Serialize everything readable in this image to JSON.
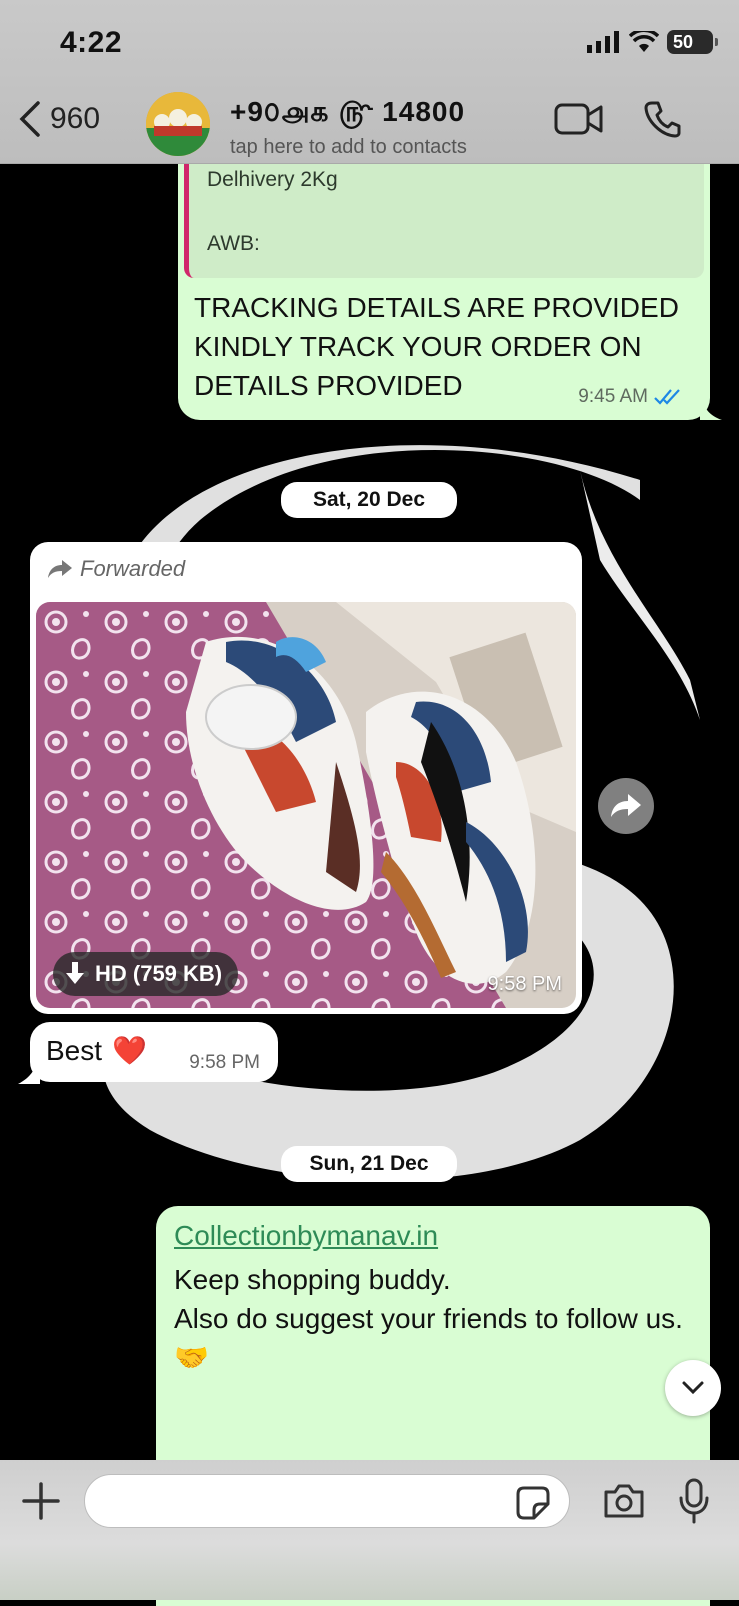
{
  "status_bar": {
    "time": "4:22",
    "battery": "50"
  },
  "header": {
    "back_count": "960",
    "contact_name": "+9௦௮௧ ௹ 14800",
    "contact_sub": "tap here to add to contacts"
  },
  "messages": {
    "m1": {
      "quote_line1": "Delhivery 2Kg",
      "quote_line2": "AWB:",
      "text": "TRACKING DETAILS ARE PROVIDED KINDLY TRACK YOUR ORDER ON DETAILS PROVIDED",
      "time": "9:45 AM"
    },
    "date1": "Sat, 20 Dec",
    "m2": {
      "forwarded": "Forwarded",
      "hd_label": "HD (759 KB)",
      "time": "9:58 PM"
    },
    "m3": {
      "text": "Best",
      "emoji": "❤️",
      "time": "9:58 PM"
    },
    "date2": "Sun, 21 Dec",
    "m4": {
      "link": "Collectionbymanav.in",
      "text": "Keep shopping buddy.\nAlso do suggest your friends to follow us. 🤝"
    }
  },
  "composer": {
    "placeholder": ""
  },
  "icons": {
    "back": "chevron-left-icon",
    "video": "video-call-icon",
    "call": "phone-icon",
    "forward": "forward-arrow-icon",
    "download": "download-icon",
    "share": "share-icon",
    "scroll": "chevron-down-icon",
    "plus": "plus-icon",
    "sticker": "sticker-icon",
    "camera": "camera-icon",
    "mic": "microphone-icon",
    "read": "double-check-icon"
  },
  "colors": {
    "outgoing": "#d9fdd3",
    "incoming": "#ffffff",
    "link": "#2e8b57",
    "read_ticks": "#1e88e5",
    "quote_bar": "#d0276b"
  }
}
